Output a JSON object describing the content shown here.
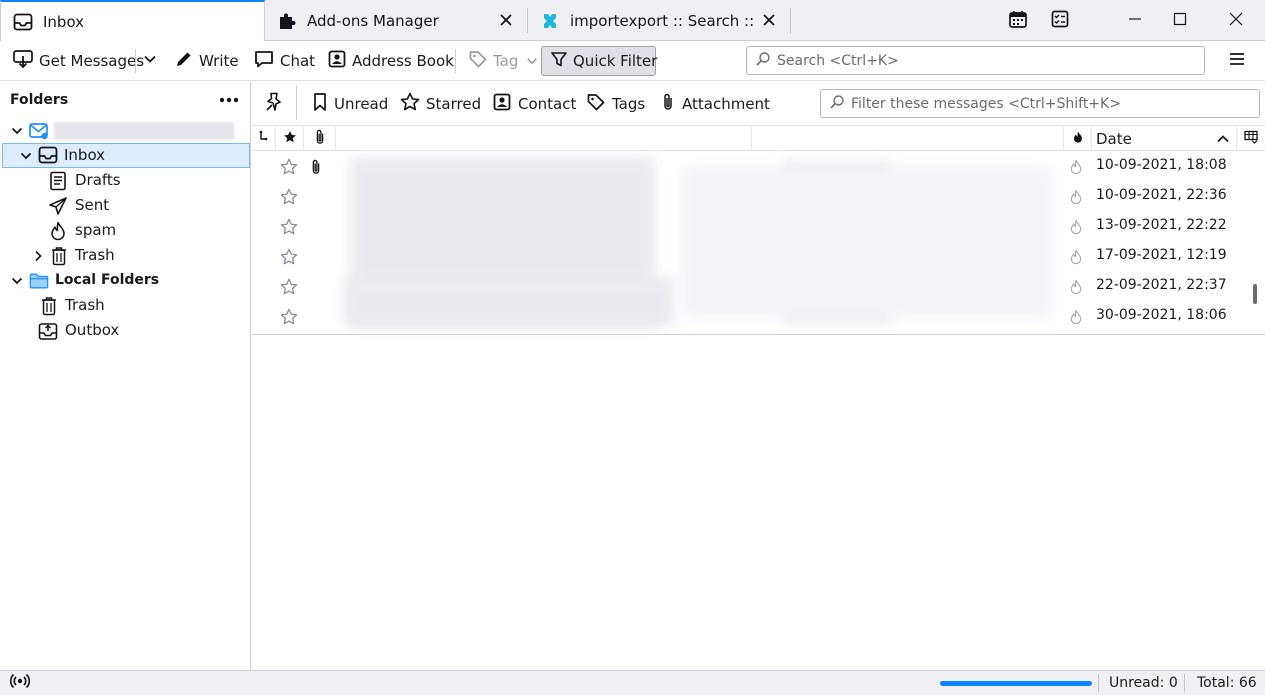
{
  "tabs": [
    {
      "label": "Inbox",
      "icon": "inbox-icon"
    },
    {
      "label": "Add-ons Manager",
      "icon": "puzzle-icon"
    },
    {
      "label": "importexport :: Search :: Add-ons",
      "icon": "addon-site-icon"
    }
  ],
  "toolbar": {
    "get_messages": "Get Messages",
    "write": "Write",
    "chat": "Chat",
    "address_book": "Address Book",
    "tag": "Tag",
    "quick_filter": "Quick Filter",
    "search_placeholder": "Search <Ctrl+K>"
  },
  "folders": {
    "header": "Folders",
    "items": [
      {
        "label": "Inbox",
        "icon": "inbox-icon"
      },
      {
        "label": "Drafts",
        "icon": "drafts-icon"
      },
      {
        "label": "Sent",
        "icon": "sent-icon"
      },
      {
        "label": "spam",
        "icon": "junk-icon"
      },
      {
        "label": "Trash",
        "icon": "trash-icon"
      },
      {
        "label": "Local Folders",
        "icon": "folder-icon"
      },
      {
        "label": "Trash",
        "icon": "trash-icon"
      },
      {
        "label": "Outbox",
        "icon": "outbox-icon"
      }
    ]
  },
  "quickfilter": {
    "unread": "Unread",
    "starred": "Starred",
    "contact": "Contact",
    "tags": "Tags",
    "attachment": "Attachment",
    "filter_placeholder": "Filter these messages <Ctrl+Shift+K>"
  },
  "threads": {
    "date_header": "Date",
    "rows": [
      {
        "date": "10-09-2021, 18:08",
        "has_attachment": true
      },
      {
        "date": "10-09-2021, 22:36",
        "has_attachment": false
      },
      {
        "date": "13-09-2021, 22:22",
        "has_attachment": false
      },
      {
        "date": "17-09-2021, 12:19",
        "has_attachment": false
      },
      {
        "date": "22-09-2021, 22:37",
        "has_attachment": false
      },
      {
        "date": "30-09-2021, 18:06",
        "has_attachment": false
      }
    ]
  },
  "status": {
    "unread": "Unread: 0",
    "total": "Total: 66",
    "progress": 1.0
  },
  "colors": {
    "accent": "#0a84ff",
    "selection": "#dceefe",
    "folder_blue": "#1e90ff"
  }
}
